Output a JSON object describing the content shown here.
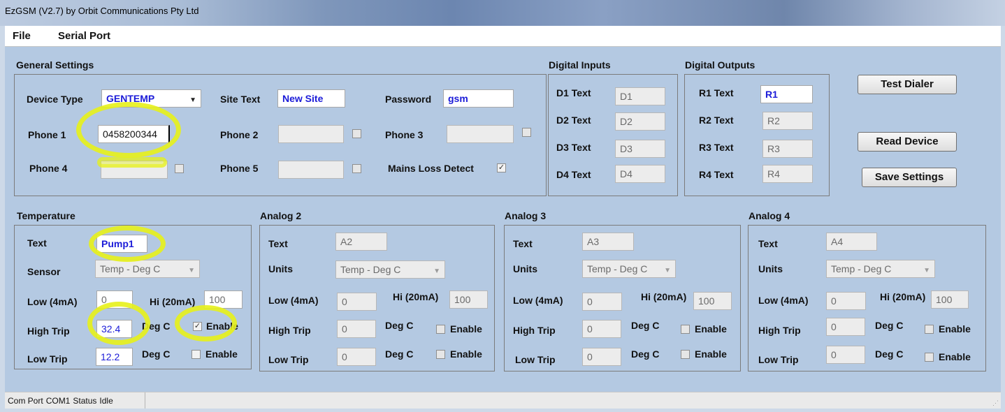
{
  "window": {
    "title": "EzGSM (V2.7) by Orbit Communications Pty Ltd"
  },
  "menu": {
    "file": "File",
    "serial_port": "Serial Port"
  },
  "general": {
    "title": "General Settings",
    "device_type_label": "Device Type",
    "device_type_value": "GENTEMP",
    "site_text_label": "Site Text",
    "site_text_value": "New Site",
    "password_label": "Password",
    "password_value": "gsm",
    "phone1_label": "Phone 1",
    "phone1_value": "0458200344",
    "phone2_label": "Phone  2",
    "phone2_value": "",
    "phone3_label": "Phone 3",
    "phone3_value": "",
    "phone4_label": "Phone 4",
    "phone4_value": "",
    "phone5_label": "Phone 5",
    "phone5_value": "",
    "mains_loss_label": "Mains Loss Detect",
    "mains_loss_checked": "✓"
  },
  "digital_inputs": {
    "title": "Digital Inputs",
    "items": [
      {
        "label": "D1 Text",
        "value": "D1"
      },
      {
        "label": "D2 Text",
        "value": "D2"
      },
      {
        "label": "D3 Text",
        "value": "D3"
      },
      {
        "label": "D4 Text",
        "value": "D4"
      }
    ]
  },
  "digital_outputs": {
    "title": "Digital Outputs",
    "items": [
      {
        "label": "R1 Text",
        "value": "R1"
      },
      {
        "label": "R2 Text",
        "value": "R2"
      },
      {
        "label": "R3 Text",
        "value": "R3"
      },
      {
        "label": "R4 Text",
        "value": "R4"
      }
    ]
  },
  "buttons": {
    "test_dialer": "Test Dialer",
    "read_device": "Read Device",
    "save_settings": "Save Settings"
  },
  "temperature": {
    "title": "Temperature",
    "text_label": "Text",
    "text_value": "Pump1",
    "sensor_label": "Sensor",
    "sensor_value": "Temp - Deg C",
    "low_label": "Low (4mA)",
    "low_value": "0",
    "hi_label": "Hi (20mA)",
    "hi_value": "100",
    "high_trip_label": "High Trip",
    "high_trip_value": "32.4",
    "high_trip_unit": "Deg C",
    "high_trip_enable": "Enable",
    "high_trip_checked": "✓",
    "low_trip_label": "Low Trip",
    "low_trip_value": "12.2",
    "low_trip_unit": "Deg C",
    "low_trip_enable": "Enable"
  },
  "analogs": [
    {
      "title": "Analog 2",
      "text_label": "Text",
      "text_value": "A2",
      "units_label": "Units",
      "units_value": "Temp - Deg C",
      "low_label": "Low (4mA)",
      "low_value": "0",
      "hi_label": "Hi (20mA)",
      "hi_value": "100",
      "high_trip_label": "High Trip",
      "high_trip_value": "0",
      "high_unit": "Deg C",
      "high_enable": "Enable",
      "low_trip_label": "Low Trip",
      "low_trip_value": "0",
      "low_unit": "Deg C",
      "low_enable": "Enable"
    },
    {
      "title": "Analog 3",
      "text_label": "Text",
      "text_value": "A3",
      "units_label": "Units",
      "units_value": "Temp - Deg C",
      "low_label": "Low (4mA)",
      "low_value": "0",
      "hi_label": "Hi (20mA)",
      "hi_value": "100",
      "high_trip_label": "High Trip",
      "high_trip_value": "0",
      "high_unit": "Deg C",
      "high_enable": "Enable",
      "low_trip_label": "Low Trip",
      "low_trip_value": "0",
      "low_unit": "Deg C",
      "low_enable": "Enable"
    },
    {
      "title": "Analog 4",
      "text_label": "Text",
      "text_value": "A4",
      "units_label": "Units",
      "units_value": "Temp - Deg C",
      "low_label": "Low (4mA)",
      "low_value": "0",
      "hi_label": "Hi (20mA)",
      "hi_value": "100",
      "high_trip_label": "High Trip",
      "high_trip_value": "0",
      "high_unit": "Deg C",
      "high_enable": "Enable",
      "low_trip_label": "Low Trip",
      "low_trip_value": "0",
      "low_unit": "Deg C",
      "low_enable": "Enable"
    }
  ],
  "status": {
    "com_port_label": "Com Port",
    "com_port_value": "COM1",
    "status_label": "Status",
    "status_value": "Idle"
  },
  "colors": {
    "highlight": "#e7f11a",
    "value_text": "#1b1bd8",
    "panel_bg": "#b4c9e2"
  }
}
